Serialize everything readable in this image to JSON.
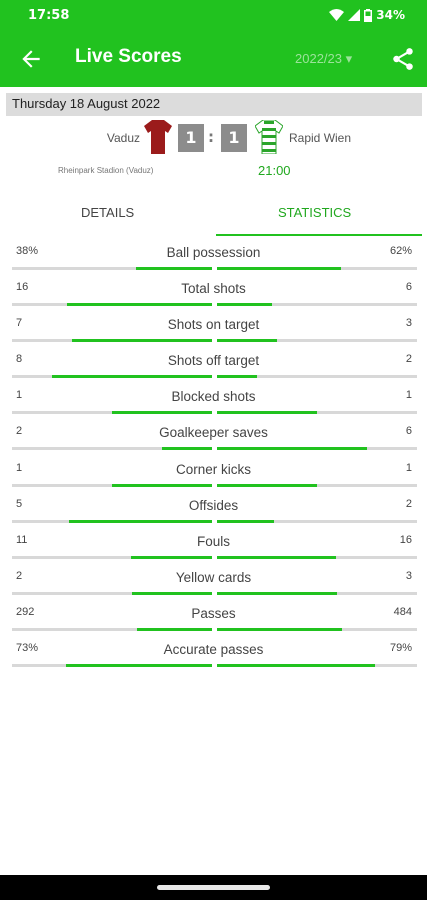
{
  "status_bar": {
    "time": "17:58",
    "battery": "34%",
    "icons": [
      "wifi-icon",
      "signal-icon",
      "battery-icon"
    ]
  },
  "app_bar": {
    "title": "Live Scores",
    "season": "2022/23",
    "season_caret": "▾",
    "back_icon": "arrow-back-icon",
    "share_icon": "share-icon"
  },
  "match": {
    "date": "Thursday 18 August 2022",
    "home_team": "Vaduz",
    "away_team": "Rapid Wien",
    "home_score": "1",
    "away_score": "1",
    "separator": ":",
    "venue": "Rheinpark Stadion (Vaduz)",
    "time": "21:00",
    "home_shirt_color": "#9b1b1b",
    "away_shirt_color": "#2aa52a"
  },
  "tabs": {
    "details": "DETAILS",
    "statistics": "STATISTICS",
    "active": "statistics"
  },
  "colors": {
    "accent": "#21c21f",
    "track": "#d8d8d8"
  },
  "stats": [
    {
      "label": "Ball possession",
      "home": "38%",
      "away": "62%",
      "home_frac": 0.38,
      "away_frac": 0.62
    },
    {
      "label": "Total shots",
      "home": "16",
      "away": "6",
      "home_frac": 0.727,
      "away_frac": 0.273
    },
    {
      "label": "Shots on target",
      "home": "7",
      "away": "3",
      "home_frac": 0.7,
      "away_frac": 0.3
    },
    {
      "label": "Shots off target",
      "home": "8",
      "away": "2",
      "home_frac": 0.8,
      "away_frac": 0.2
    },
    {
      "label": "Blocked shots",
      "home": "1",
      "away": "1",
      "home_frac": 0.5,
      "away_frac": 0.5
    },
    {
      "label": "Goalkeeper saves",
      "home": "2",
      "away": "6",
      "home_frac": 0.25,
      "away_frac": 0.75
    },
    {
      "label": "Corner kicks",
      "home": "1",
      "away": "1",
      "home_frac": 0.5,
      "away_frac": 0.5
    },
    {
      "label": "Offsides",
      "home": "5",
      "away": "2",
      "home_frac": 0.714,
      "away_frac": 0.286
    },
    {
      "label": "Fouls",
      "home": "11",
      "away": "16",
      "home_frac": 0.407,
      "away_frac": 0.593
    },
    {
      "label": "Yellow cards",
      "home": "2",
      "away": "3",
      "home_frac": 0.4,
      "away_frac": 0.6
    },
    {
      "label": "Passes",
      "home": "292",
      "away": "484",
      "home_frac": 0.376,
      "away_frac": 0.624
    },
    {
      "label": "Accurate passes",
      "home": "73%",
      "away": "79%",
      "home_frac": 0.73,
      "away_frac": 0.79
    }
  ]
}
